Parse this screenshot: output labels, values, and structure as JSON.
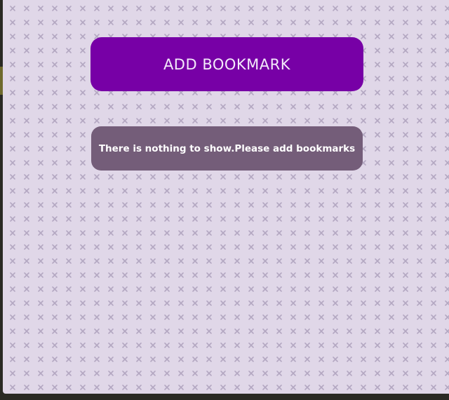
{
  "toolbar": {
    "add_bookmark_label": "ADD BOOKMARK"
  },
  "bookmarks": {
    "items": [],
    "empty_message": "There is nothing to show.Please add bookmarks"
  },
  "colors": {
    "accent": "#7700a6",
    "message_background": "#745d79",
    "page_background": "#e0d7e8",
    "pattern": "#b3a7c1"
  }
}
